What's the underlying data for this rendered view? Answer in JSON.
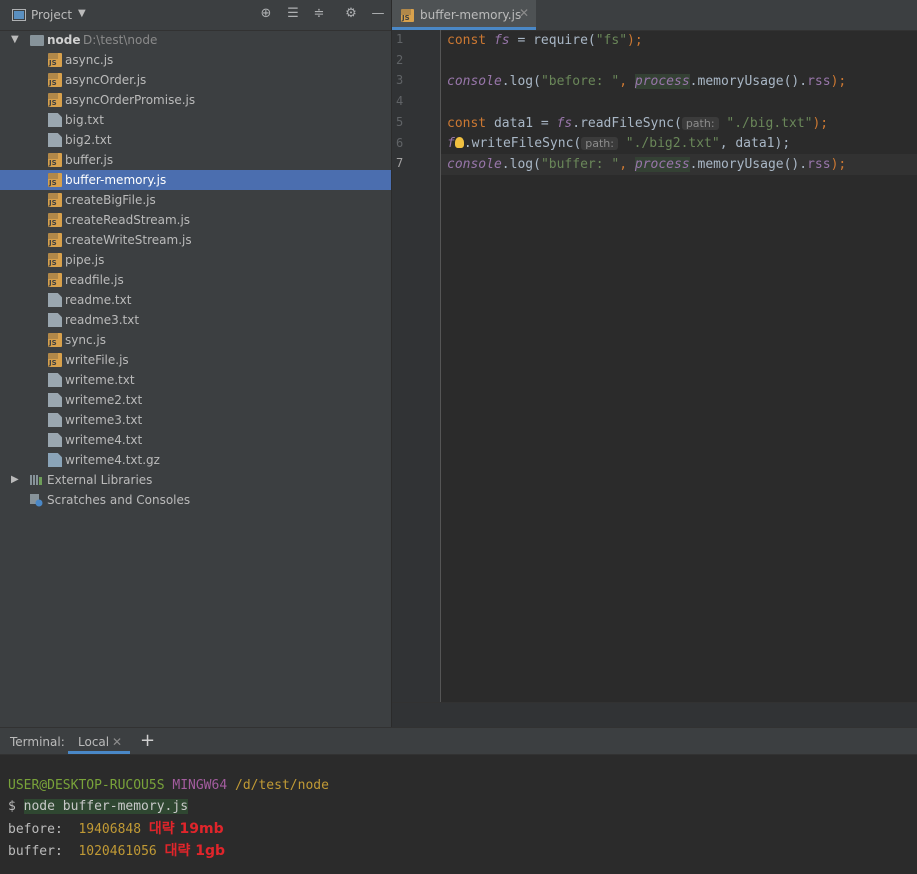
{
  "project_panel": {
    "title": "Project",
    "root": {
      "name": "node",
      "path": "D:\\test\\node"
    },
    "files": [
      {
        "name": "async.js",
        "type": "js"
      },
      {
        "name": "asyncOrder.js",
        "type": "js"
      },
      {
        "name": "asyncOrderPromise.js",
        "type": "js"
      },
      {
        "name": "big.txt",
        "type": "txt"
      },
      {
        "name": "big2.txt",
        "type": "txt"
      },
      {
        "name": "buffer.js",
        "type": "js"
      },
      {
        "name": "buffer-memory.js",
        "type": "js",
        "selected": true
      },
      {
        "name": "createBigFile.js",
        "type": "js"
      },
      {
        "name": "createReadStream.js",
        "type": "js"
      },
      {
        "name": "createWriteStream.js",
        "type": "js"
      },
      {
        "name": "pipe.js",
        "type": "js"
      },
      {
        "name": "readfile.js",
        "type": "js"
      },
      {
        "name": "readme.txt",
        "type": "txt"
      },
      {
        "name": "readme3.txt",
        "type": "txt"
      },
      {
        "name": "sync.js",
        "type": "js"
      },
      {
        "name": "writeFile.js",
        "type": "js"
      },
      {
        "name": "writeme.txt",
        "type": "txt"
      },
      {
        "name": "writeme2.txt",
        "type": "txt"
      },
      {
        "name": "writeme3.txt",
        "type": "txt"
      },
      {
        "name": "writeme4.txt",
        "type": "txt"
      },
      {
        "name": "writeme4.txt.gz",
        "type": "gz"
      }
    ],
    "external_libraries": "External Libraries",
    "scratches": "Scratches and Consoles"
  },
  "editor": {
    "tab": "buffer-memory.js",
    "line_numbers": [
      "1",
      "2",
      "3",
      "4",
      "5",
      "6",
      "7"
    ],
    "current_line": "7",
    "code": {
      "l1": {
        "kw": "const",
        "fs": "fs",
        "eq": " = require(",
        "str": "\"fs\"",
        "end": ");"
      },
      "l3": {
        "console": "console",
        "log": ".log(",
        "str": "\"before: \"",
        "comma": ", ",
        "process": "process",
        "rest": ".memoryUsage().",
        "rss": "rss",
        "end": ");"
      },
      "l5": {
        "kw": "const",
        "var": " data1 = ",
        "fs": "fs",
        "call": ".readFileSync(",
        "hint": "path:",
        "str": "\"./big.txt\"",
        "end": ");"
      },
      "l6": {
        "fs": "f",
        "call": ".writeFileSync(",
        "hint": "path:",
        "str": "\"./big2.txt\"",
        "end": ", data1);"
      },
      "l7": {
        "console": "console",
        "log": ".log(",
        "str": "\"buffer: \"",
        "comma": ", ",
        "process": "process",
        "rest": ".memoryUsage().",
        "rss": "rss",
        "end": ");"
      }
    }
  },
  "terminal": {
    "label": "Terminal:",
    "tab": "Local",
    "prompt_user": "USER@DESKTOP-RUCOU5S",
    "prompt_env": "MINGW64",
    "prompt_path": "/d/test/node",
    "dollar": "$",
    "command": "node buffer-memory.js",
    "out1_label": "before:  ",
    "out1_value": "19406848",
    "out1_note": "대략 19mb",
    "out2_label": "buffer:  ",
    "out2_value": "1020461056",
    "out2_note": "대략 1gb"
  },
  "colors": {
    "selection": "#4b6eaf",
    "keyword": "#cc7832",
    "string": "#6a8759",
    "annotation": "#e0252b"
  }
}
